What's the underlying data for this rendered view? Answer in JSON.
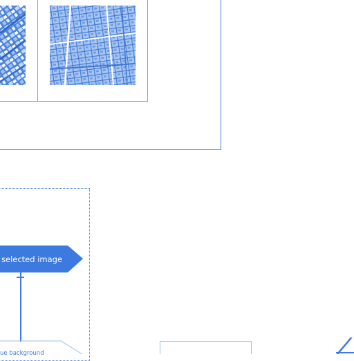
{
  "nodes": {
    "selected_image_label": "selected image",
    "background_label": "ue background"
  },
  "images": [
    {
      "name": "aerial-thumbnail-left",
      "description": "aerial photo, blue tint"
    },
    {
      "name": "aerial-thumbnail-right",
      "description": "aerial street map, blue tint"
    }
  ],
  "colors": {
    "accent": "#3d7ae0",
    "frame": "#4a7fd6",
    "tint_light": "#a9c6f2",
    "tint_dark": "#3f78d4"
  }
}
